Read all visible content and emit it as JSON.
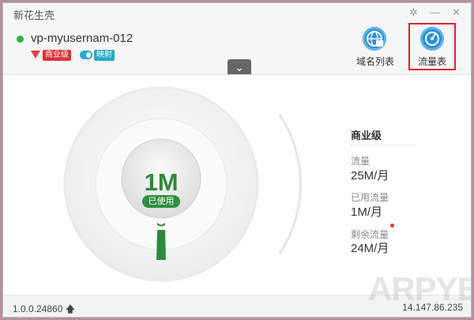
{
  "window": {
    "title": "新花生壳",
    "settings_glyph": "✲",
    "minimize_glyph": "—",
    "close_glyph": "✕"
  },
  "server": {
    "name": "vp-myusernam-012",
    "tier_badge": "商业级",
    "mapping_badge": "映射"
  },
  "toolbar": {
    "domain_list_label": "域名列表",
    "traffic_label": "流量表"
  },
  "collapse_glyph": "⌄",
  "gauge": {
    "used_value": "1M",
    "used_label": "已使用",
    "used_fraction": 0.04
  },
  "info": {
    "tier": "商业级",
    "traffic_label": "流量",
    "traffic_value": "25M/月",
    "used_label": "已用流量",
    "used_value": "1M/月",
    "remaining_label": "剩余流量",
    "remaining_value": "24M/月"
  },
  "footer": {
    "version": "1.0.0.24860",
    "update_glyph": "🡅",
    "ip": "14.147.86.235"
  },
  "watermark": "ARPYE",
  "colors": {
    "accent_blue": "#2b8fd4",
    "status_green": "#2fb34a",
    "gauge_green": "#2d8a3c",
    "badge_red": "#d9343a",
    "highlight_red": "#d6272e"
  }
}
